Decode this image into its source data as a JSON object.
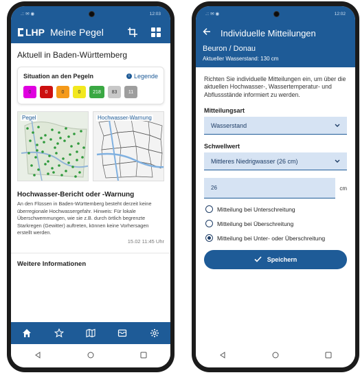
{
  "left": {
    "status": {
      "left": ". ⚡︎⛔",
      "time": "12:03"
    },
    "app": {
      "logo": "LHP",
      "title": "Meine Pegel"
    },
    "section_title": "Aktuell in Baden-Württemberg",
    "situation": {
      "title": "Situation an den Pegeln",
      "legend": "Legende",
      "badges": [
        {
          "value": "0",
          "color": "#e000e0"
        },
        {
          "value": "0",
          "color": "#cc1010"
        },
        {
          "value": "0",
          "color": "#f59a1a"
        },
        {
          "value": "0",
          "color": "#f2e81e"
        },
        {
          "value": "218",
          "color": "#3aa843"
        },
        {
          "value": "83",
          "color": "#c8c8c8"
        },
        {
          "value": "11",
          "color": "#9e9e9e"
        }
      ]
    },
    "maps": {
      "gauge": "Pegel",
      "flood": "Hochwasser-Warnung"
    },
    "news": {
      "title": "Hochwasser-Bericht oder -Warnung",
      "body": "An den Flüssen in Baden-Württemberg besteht derzeit keine überregionale Hochwassergefahr. Hinweis: Für lokale Überschwemmungen, wie sie z.B. durch örtlich begrenzte Starkregen (Gewitter) auftreten, können keine Vorhersagen erstellt werden.",
      "time": "15.02 11:45 Uhr"
    },
    "more": "Weitere Informationen"
  },
  "right": {
    "status": {
      "time": "12:02"
    },
    "title": "Individuelle Mitteilungen",
    "location": "Beuron / Donau",
    "level": "Aktueller Wasserstand: 130 cm",
    "description": "Richten Sie individuelle Mitteilungen ein, um über die aktuellen Hochwasser-, Wassertemperatur- und Abflussstände informiert zu werden.",
    "type_label": "Mitteilungsart",
    "type_value": "Wasserstand",
    "threshold_label": "Schwellwert",
    "threshold_value": "Mittleres Niedrigwasser (26 cm)",
    "number_value": "26",
    "unit": "cm",
    "radios": [
      {
        "label": "Mitteilung bei Unterschreitung",
        "checked": false
      },
      {
        "label": "Mitteilung bei Überschreitung",
        "checked": false
      },
      {
        "label": "Mitteilung bei Unter- oder Überschreitung",
        "checked": true
      }
    ],
    "save": "Speichern"
  },
  "colors": {
    "brand": "#1e5b97",
    "field": "#d6e3f3"
  }
}
